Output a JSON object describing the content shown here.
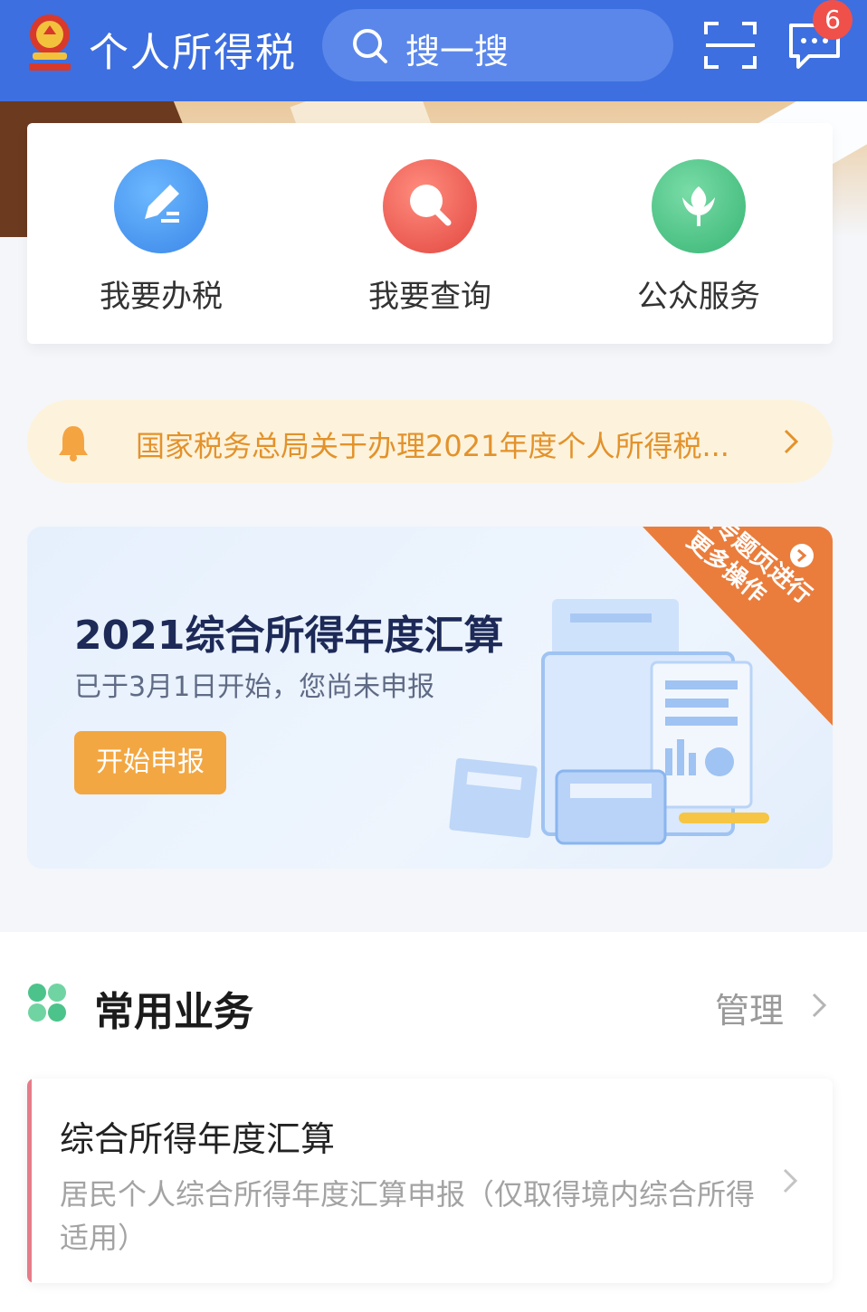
{
  "header": {
    "title": "个人所得税",
    "search_placeholder": "搜一搜",
    "message_badge": "6"
  },
  "quick_services": [
    {
      "label": "我要办税",
      "icon": "pen-icon",
      "color": "#4a9cf0"
    },
    {
      "label": "我要查询",
      "icon": "magnifier-icon",
      "color": "#e8554e"
    },
    {
      "label": "公众服务",
      "icon": "flower-icon",
      "color": "#45c287"
    }
  ],
  "notice": {
    "text": "国家税务总局关于办理2021年度个人所得税..."
  },
  "promo": {
    "title": "2021综合所得年度汇算",
    "subtitle": "已于3月1日开始，您尚未申报",
    "button": "开始申报",
    "corner_text": "进入专题页进行更多操作"
  },
  "common_business": {
    "title": "常用业务",
    "manage": "管理",
    "items": [
      {
        "title": "综合所得年度汇算",
        "description": "居民个人综合所得年度汇算申报（仅取得境内综合所得适用）"
      }
    ]
  },
  "colors": {
    "header": "#3d6fe0",
    "accent_orange": "#f2a742",
    "notice_text": "#e3922b"
  }
}
